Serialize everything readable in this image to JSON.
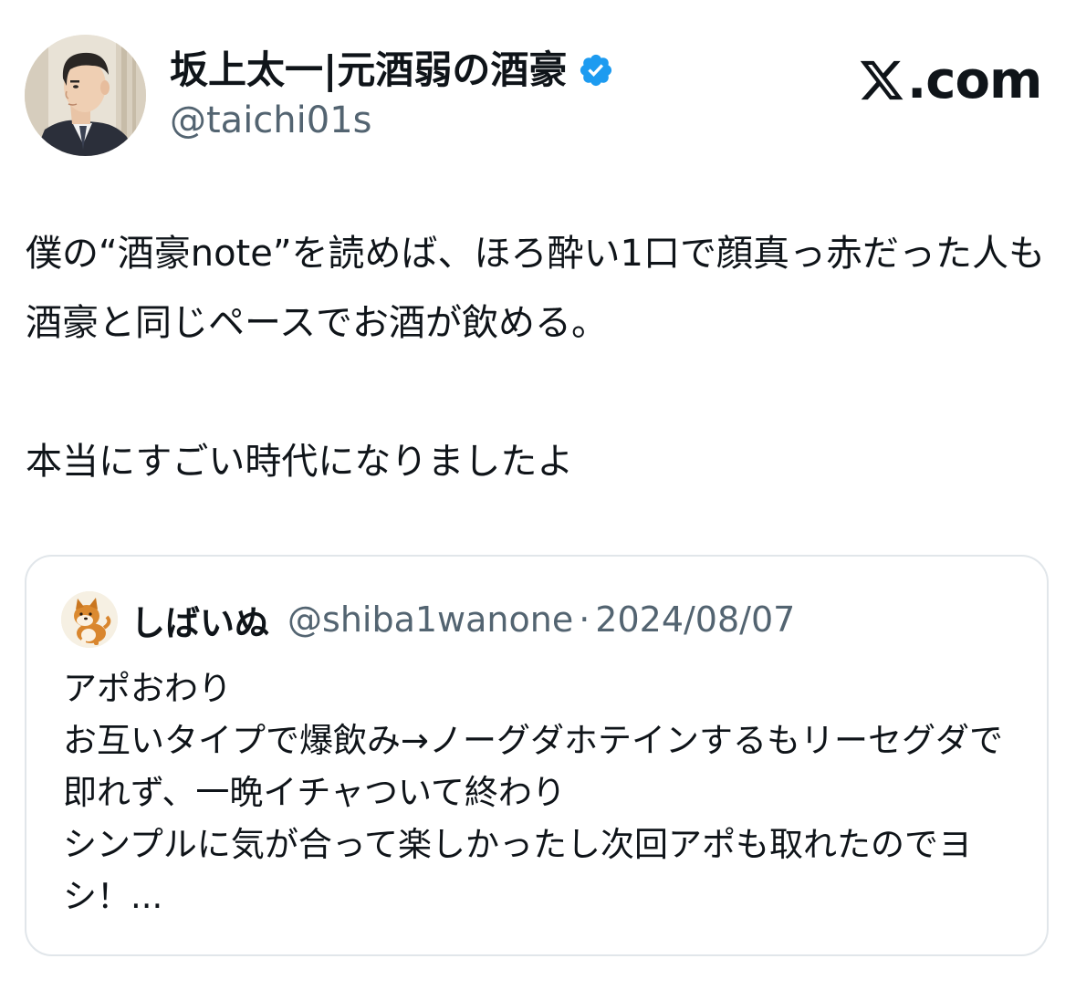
{
  "author": {
    "display_name": "坂上太一|元酒弱の酒豪",
    "handle": "@taichi01s",
    "verified": true,
    "avatar_icon": "man-in-suit-avatar"
  },
  "brand": {
    "logo_icon": "x-logo-icon",
    "suffix": ".com"
  },
  "tweet": {
    "text": "僕の“酒豪note”を読めば、ほろ酔い1口で顔真っ赤だった人も酒豪と同じペースでお酒が飲める。\n\n本当にすごい時代になりましたよ"
  },
  "quoted_tweet": {
    "author_name": "しばいぬ",
    "author_handle": "@shiba1wanone",
    "separator": "·",
    "date": "2024/08/07",
    "avatar_icon": "shiba-dog-avatar",
    "text": "アポおわり\nお互いタイプで爆飲み→ノーグダホテインするもリーセグダで即れず、一晩イチャついて終わり\nシンプルに気が合って楽しかったし次回アポも取れたのでヨシ！..."
  },
  "colors": {
    "text_primary": "#0f1419",
    "text_secondary": "#536471",
    "verified_blue": "#1d9bf0",
    "border": "#e1e6ea"
  }
}
